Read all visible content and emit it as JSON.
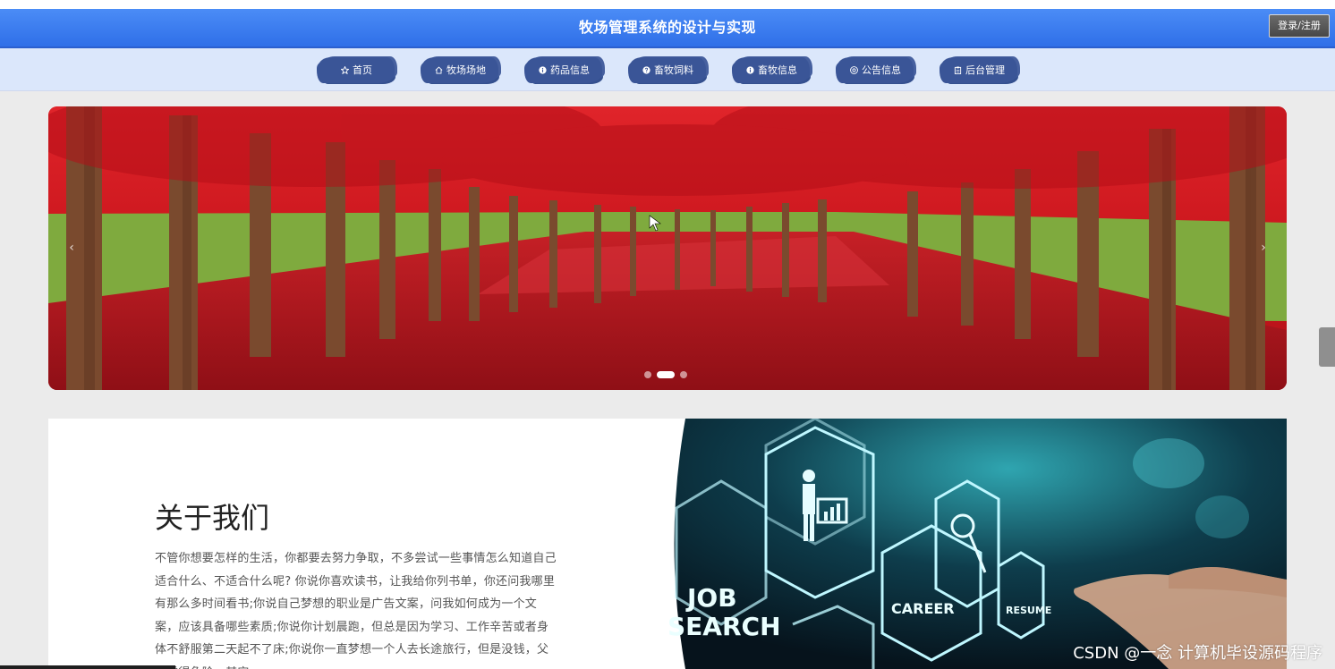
{
  "header": {
    "title": "牧场管理系统的设计与实现",
    "login_label": "登录/注册"
  },
  "nav": {
    "items": [
      {
        "label": "首页",
        "icon": "star-icon"
      },
      {
        "label": "牧场场地",
        "icon": "home-icon"
      },
      {
        "label": "药品信息",
        "icon": "info-circle-icon"
      },
      {
        "label": "畜牧饲料",
        "icon": "question-circle-icon"
      },
      {
        "label": "畜牧信息",
        "icon": "info-circle-icon"
      },
      {
        "label": "公告信息",
        "icon": "settings-circle-icon"
      },
      {
        "label": "后台管理",
        "icon": "clipboard-icon"
      }
    ]
  },
  "carousel": {
    "prev_label": "‹",
    "next_label": "›",
    "slide_count": 3,
    "active_slide": 2
  },
  "about": {
    "title": "关于我们",
    "text": "不管你想要怎样的生活，你都要去努力争取，不多尝试一些事情怎么知道自己适合什么、不适合什么呢? 你说你喜欢读书，让我给你列书单，你还问我哪里有那么多时间看书;你说自己梦想的职业是广告文案，问我如何成为一个文案，应该具备哪些素质;你说你计划晨跑，但总是因为学习、工作辛苦或者身体不舒服第二天起不了床;你说你一直梦想一个人去长途旅行，但是没钱，父母觉得危险。其实，",
    "image_words": [
      "JOB",
      "SEARCH",
      "CAREER",
      "RESUME"
    ]
  },
  "watermark": "CSDN @一念 计算机毕设源码程序",
  "colors": {
    "header_blue": "#2f6fe8",
    "nav_bg": "#dbe7fb",
    "nav_item": "#3a5597"
  }
}
